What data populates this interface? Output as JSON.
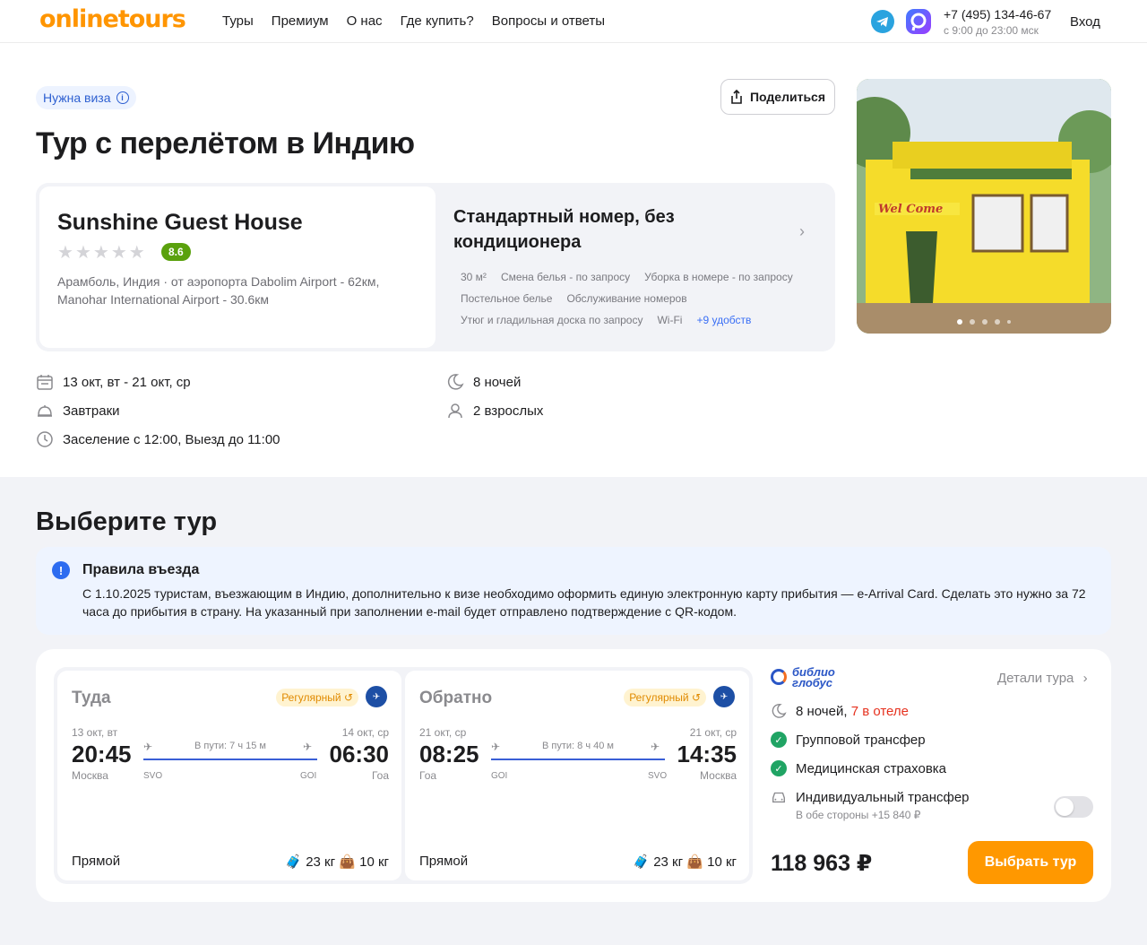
{
  "header": {
    "logo": "onlinetours",
    "nav": [
      "Туры",
      "Премиум",
      "О нас",
      "Где купить?",
      "Вопросы и ответы"
    ],
    "phone": "+7 (495) 134-46-67",
    "hours": "с 9:00 до 23:00 мск",
    "login": "Вход"
  },
  "hero": {
    "visa_badge": "Нужна виза",
    "title": "Тур с перелётом в Индию",
    "share": "Поделиться"
  },
  "hotel": {
    "name": "Sunshine Guest House",
    "stars_filled": 0,
    "stars_total": 5,
    "rating": "8.6",
    "location": "Арамболь, Индия · от аэропорта Dabolim Airport - 62км, Manohar International Airport - 30.6км"
  },
  "room": {
    "title": "Стандартный номер, без кондиционера",
    "amenities": [
      "30 м²",
      "Смена белья - по запросу",
      "Уборка в номере - по запросу",
      "Постельное белье",
      "Обслуживание номеров",
      "Утюг и гладильная доска по запросу",
      "Wi-Fi"
    ],
    "more": "+9 удобств"
  },
  "photo": {
    "sign": "Wel Come",
    "slides": 5,
    "active": 0
  },
  "trip": {
    "dates": "13 окт, вт - 21 окт, ср",
    "meals": "Завтраки",
    "checkin": "Заселение с 12:00, Выезд до 11:00",
    "nights": "8 ночей",
    "guests": "2 взрослых"
  },
  "choose": {
    "title": "Выберите тур",
    "entry_title": "Правила въезда",
    "entry_text": "С 1.10.2025 туристам, въезжающим в Индию, дополнительно к визе необходимо оформить единую электронную карту прибытия — e-Arrival Card. Сделать это нужно за 72 часа до прибытия в страну. На указанный при заполнении e-mail будет отправлено подтверждение с QR-кодом."
  },
  "flights": [
    {
      "direction": "Туда",
      "badge": "Регулярный",
      "dep_date": "13 окт, вт",
      "arr_date": "14 окт, ср",
      "dep_time": "20:45",
      "arr_time": "06:30",
      "duration": "В пути: 7 ч 15 м",
      "dep_city": "Москва",
      "arr_city": "Гоа",
      "dep_code": "SVO",
      "arr_code": "GOI",
      "type": "Прямой",
      "baggage": "23 кг",
      "hand": "10 кг"
    },
    {
      "direction": "Обратно",
      "badge": "Регулярный",
      "dep_date": "21 окт, ср",
      "arr_date": "21 окт, ср",
      "dep_time": "08:25",
      "arr_time": "14:35",
      "duration": "В пути: 8 ч 40 м",
      "dep_city": "Гоа",
      "arr_city": "Москва",
      "dep_code": "GOI",
      "arr_code": "SVO",
      "type": "Прямой",
      "baggage": "23 кг",
      "hand": "10 кг"
    }
  ],
  "offer": {
    "operator_line1": "библио",
    "operator_line2": "глобус",
    "details": "Детали тура",
    "nights": "8 ночей,",
    "in_hotel": "7 в отеле",
    "transfer": "Групповой трансфер",
    "insurance": "Медицинская страховка",
    "ind_transfer": "Индивидуальный трансфер",
    "ind_transfer_sub": "В обе стороны +15 840 ₽",
    "ind_transfer_on": false,
    "price": "118 963 ₽",
    "cta": "Выбрать тур"
  },
  "colors": {
    "brand": "#ff9500",
    "cta": "#ff9800",
    "rating": "#5aa10d",
    "link": "#3a6ff5",
    "check": "#20a464",
    "accent_red": "#e6321f"
  }
}
